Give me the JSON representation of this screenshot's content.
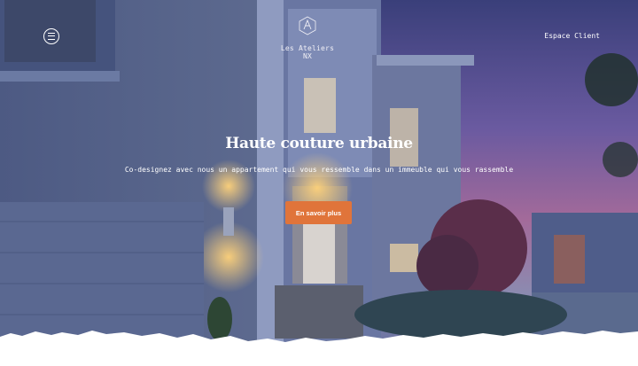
{
  "header": {
    "menu_icon": "hamburger-circle-icon",
    "logo_icon": "compass-monogram-icon",
    "brand": "Les Ateliers NX",
    "client_link": "Espace Client"
  },
  "hero": {
    "title": "Haute couture urbaine",
    "subtitle": "Co-designez avec nous un appartement qui vous ressemble dans un immeuble qui vous rassemble",
    "cta_label": "En savoir plus",
    "cta_color": "#e0743a"
  }
}
